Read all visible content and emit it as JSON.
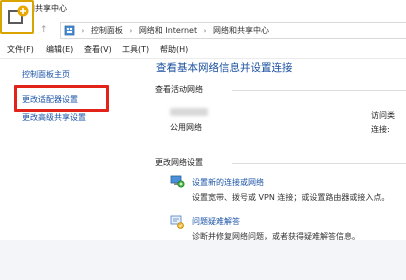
{
  "window": {
    "title": "络和共享中心"
  },
  "address_bar": {
    "breadcrumbs": [
      "控制面板",
      "网络和 Internet",
      "网络和共享中心"
    ]
  },
  "menu": {
    "items": [
      "文件(F)",
      "编辑(E)",
      "查看(V)",
      "工具(T)",
      "帮助(H)"
    ]
  },
  "sidebar": {
    "items": [
      {
        "label": "控制面板主页"
      },
      {
        "label": "更改适配器设置"
      },
      {
        "label": "更改高级共享设置"
      }
    ]
  },
  "main": {
    "title": "查看基本网络信息并设置连接",
    "active_networks_label": "查看活动网络",
    "network_type": "公用网络",
    "access_type_label": "访问类",
    "connections_label": "连接:",
    "change_settings_label": "更改网络设置",
    "tasks": [
      {
        "icon": "network-setup-icon",
        "link": "设置新的连接或网络",
        "desc": "设置宽带、拨号或 VPN 连接；或设置路由器或接入点。"
      },
      {
        "icon": "troubleshoot-icon",
        "link": "问题疑难解答",
        "desc": "诊断并修复网络问题，或者获得疑难解答信息。"
      }
    ]
  },
  "colors": {
    "link": "#1a53a8",
    "title": "#1a4fa0",
    "highlight": "#e2231a"
  }
}
